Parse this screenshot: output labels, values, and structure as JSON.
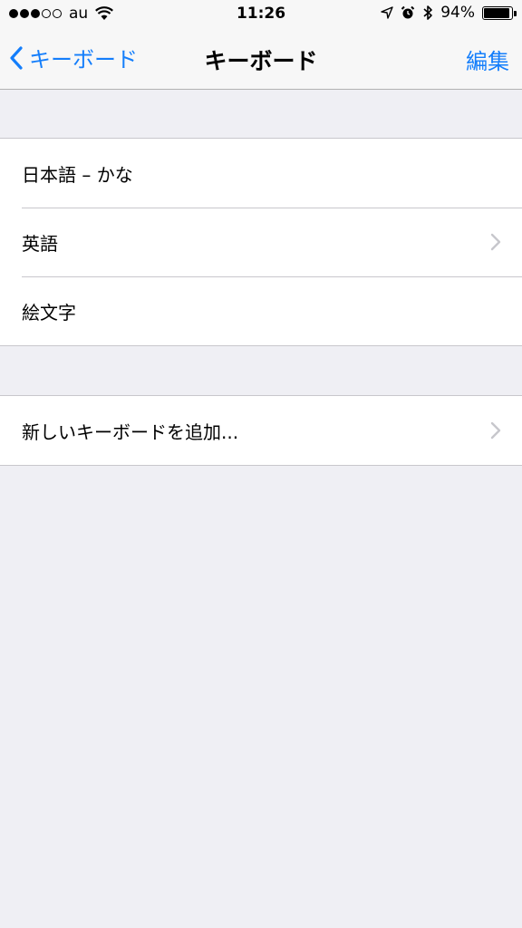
{
  "status_bar": {
    "carrier": "au",
    "time": "11:26",
    "battery_text": "94%",
    "battery_level": 0.94,
    "signal_filled": 3,
    "signal_total": 5
  },
  "nav": {
    "back_label": "キーボード",
    "title": "キーボード",
    "edit_label": "編集",
    "accent_color": "#147efb"
  },
  "keyboards": [
    {
      "label": "日本語 – かな",
      "has_chevron": false
    },
    {
      "label": "英語",
      "has_chevron": true
    },
    {
      "label": "絵文字",
      "has_chevron": false
    }
  ],
  "add_keyboard": {
    "label": "新しいキーボードを追加..."
  },
  "icons": {
    "back": "chevron-left-icon",
    "chevron": "chevron-right-icon",
    "wifi": "wifi-icon",
    "location": "location-arrow-icon",
    "alarm": "alarm-clock-icon",
    "bluetooth": "bluetooth-icon",
    "battery": "battery-icon"
  }
}
